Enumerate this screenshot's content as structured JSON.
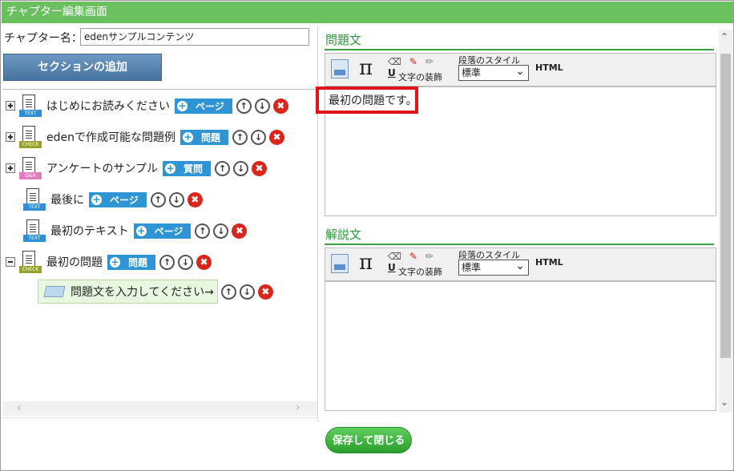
{
  "window_title": "チャプター編集画面",
  "chapter": {
    "label": "チャプター名：",
    "value": "edenサンプルコンテンツ"
  },
  "add_section_label": "セクションの追加",
  "tree": [
    {
      "kind": "item",
      "expander": "plus",
      "icon_tag": "TEXT",
      "label": "はじめにお読みください",
      "button": "ページ"
    },
    {
      "kind": "item",
      "expander": "plus",
      "icon_tag": "CHECK",
      "label": "edenで作成可能な問題例",
      "button": "問題"
    },
    {
      "kind": "item",
      "expander": "plus",
      "icon_tag": "Q&A",
      "label": "アンケートのサンプル",
      "button": "質問"
    },
    {
      "kind": "item",
      "expander": "none",
      "icon_tag": "TEXT",
      "label": "最後に",
      "button": "ページ"
    },
    {
      "kind": "item",
      "expander": "none",
      "icon_tag": "TEXT",
      "label": "最初のテキスト",
      "button": "ページ"
    },
    {
      "kind": "item",
      "expander": "minus",
      "icon_tag": "CHECK",
      "label": "最初の問題",
      "button": "問題"
    },
    {
      "kind": "question",
      "label": "問題文を入力してください→"
    }
  ],
  "row_icons": {
    "up": "↑",
    "down": "↓",
    "delete": "✖",
    "add": "+"
  },
  "question_section": {
    "title": "問題文",
    "content": "最初の問題です。"
  },
  "explanation_section": {
    "title": "解説文",
    "content": ""
  },
  "toolbar": {
    "pi": "π",
    "decoration_label": "文字の装飾",
    "style_label": "段落のスタイル",
    "style_value": "標準",
    "html_label": "HTML",
    "underline": "U"
  },
  "save_label": "保存して閉じる",
  "colors": {
    "titlebar": "#6abf5f",
    "accent_blue": "#2e94d3",
    "section_green": "#2a9a3a",
    "highlight_red": "#e0141b"
  }
}
